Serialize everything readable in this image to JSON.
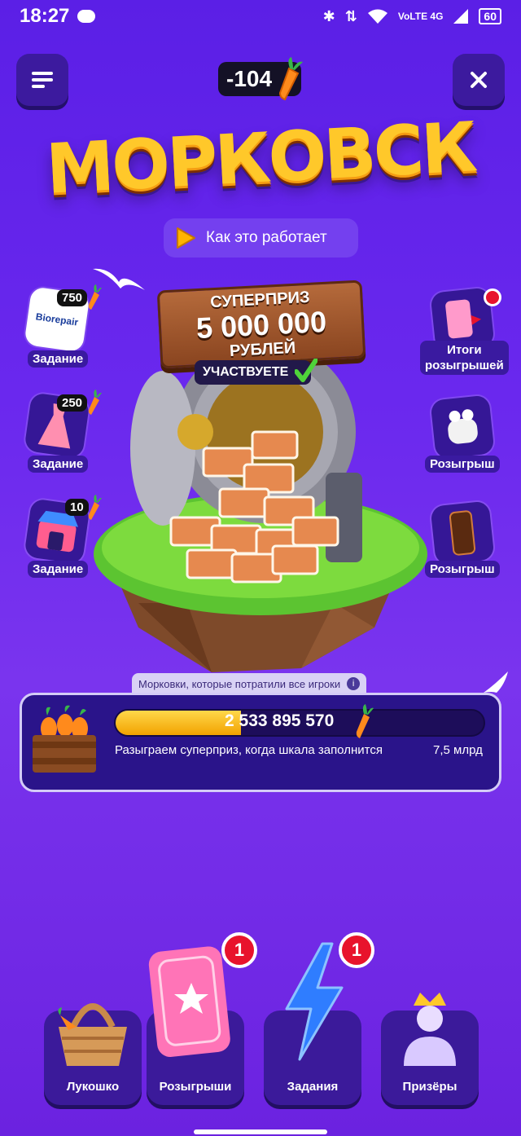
{
  "status": {
    "time": "18:27",
    "network": "VoLTE 4G",
    "battery": "60"
  },
  "header": {
    "carrot_balance": "-104"
  },
  "title": "МОРКОВСК",
  "how_it_works": "Как это работает",
  "superprize": {
    "line1": "СУПЕРПРИЗ",
    "amount": "5 000 000",
    "line3": "РУБЛЕЙ",
    "status": "УЧАСТВУЕТЕ"
  },
  "left_tasks": [
    {
      "label": "Задание",
      "reward": "750",
      "brand": "Biorepair"
    },
    {
      "label": "Задание",
      "reward": "250"
    },
    {
      "label": "Задание",
      "reward": "10"
    }
  ],
  "right_items": [
    {
      "label_line1": "Итоги",
      "label_line2": "розыгрышей"
    },
    {
      "label": "Розыгрыш"
    },
    {
      "label": "Розыгрыш"
    }
  ],
  "progress": {
    "caption": "Морковки, которые потратили все игроки",
    "value": "2 533 895 570",
    "fraction": 0.34,
    "description": "Разыграем суперприз, когда шкала заполнится",
    "max": "7,5 млрд"
  },
  "bottom_nav": [
    {
      "label": "Лукошко"
    },
    {
      "label": "Розыгрыши",
      "badge": "1"
    },
    {
      "label": "Задания",
      "badge": "1"
    },
    {
      "label": "Призёры"
    }
  ],
  "colors": {
    "accent": "#ffc82a",
    "badge": "#e8132c",
    "panel": "#2a148a"
  }
}
